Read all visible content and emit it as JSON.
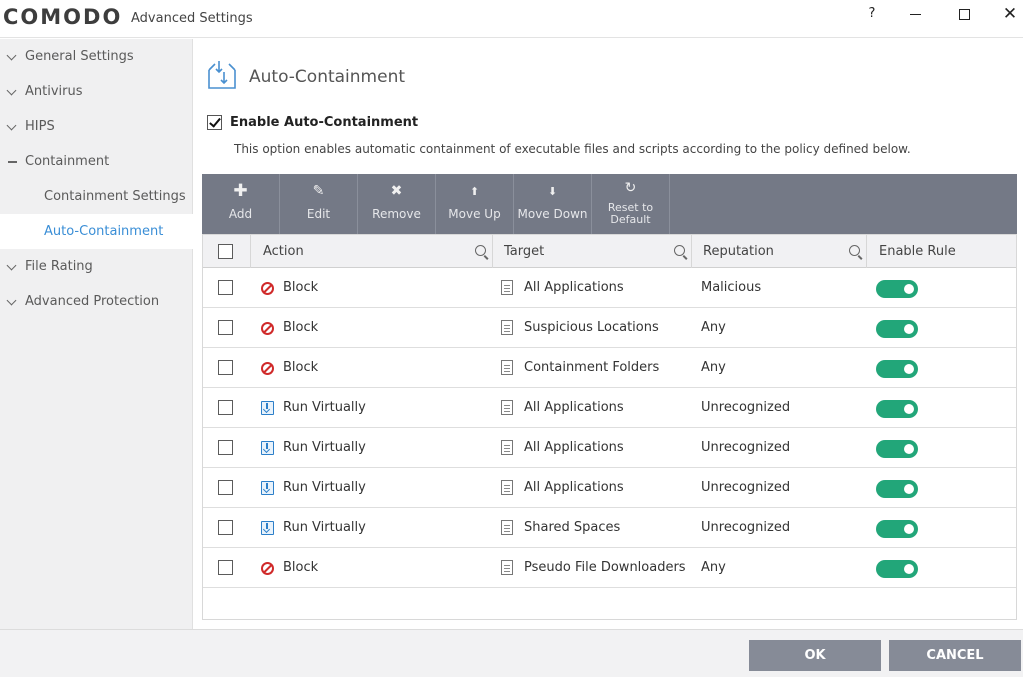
{
  "window": {
    "brand": "COMODO",
    "title": "Advanced Settings",
    "help_label": "?",
    "close_label": "✕"
  },
  "sidebar": {
    "items": [
      {
        "label": "General Settings",
        "state": "collapsed"
      },
      {
        "label": "Antivirus",
        "state": "collapsed"
      },
      {
        "label": "HIPS",
        "state": "collapsed"
      },
      {
        "label": "Containment",
        "state": "expanded"
      },
      {
        "label": "Containment Settings",
        "state": "sub"
      },
      {
        "label": "Auto-Containment",
        "state": "sub-active"
      },
      {
        "label": "File Rating",
        "state": "collapsed"
      },
      {
        "label": "Advanced Protection",
        "state": "collapsed"
      }
    ]
  },
  "page": {
    "title": "Auto-Containment",
    "enable_label": "Enable Auto-Containment",
    "enable_checked": true,
    "description": "This option enables automatic containment of executable files and scripts according to the policy defined below."
  },
  "toolbar": {
    "buttons": [
      {
        "icon": "plus-icon",
        "label": "Add"
      },
      {
        "icon": "edit-icon",
        "label": "Edit"
      },
      {
        "icon": "remove-icon",
        "label": "Remove"
      },
      {
        "icon": "arrow-up-icon",
        "label": "Move Up"
      },
      {
        "icon": "arrow-down-icon",
        "label": "Move Down"
      },
      {
        "icon": "reset-icon",
        "label_line1": "Reset to",
        "label_line2": "Default"
      }
    ]
  },
  "table": {
    "columns": [
      "Action",
      "Target",
      "Reputation",
      "Enable Rule"
    ],
    "rows": [
      {
        "action": "Block",
        "action_icon": "block-icon",
        "target": "All Applications",
        "reputation": "Malicious",
        "enabled": true
      },
      {
        "action": "Block",
        "action_icon": "block-icon",
        "target": "Suspicious Locations",
        "reputation": "Any",
        "enabled": true
      },
      {
        "action": "Block",
        "action_icon": "block-icon",
        "target": "Containment Folders",
        "reputation": "Any",
        "enabled": true
      },
      {
        "action": "Run Virtually",
        "action_icon": "run-virtually-icon",
        "target": "All Applications",
        "reputation": "Unrecognized",
        "enabled": true
      },
      {
        "action": "Run Virtually",
        "action_icon": "run-virtually-icon",
        "target": "All Applications",
        "reputation": "Unrecognized",
        "enabled": true
      },
      {
        "action": "Run Virtually",
        "action_icon": "run-virtually-icon",
        "target": "All Applications",
        "reputation": "Unrecognized",
        "enabled": true
      },
      {
        "action": "Run Virtually",
        "action_icon": "run-virtually-icon",
        "target": "Shared Spaces",
        "reputation": "Unrecognized",
        "enabled": true
      },
      {
        "action": "Block",
        "action_icon": "block-icon",
        "target": "Pseudo File Downloaders",
        "reputation": "Any",
        "enabled": true
      }
    ]
  },
  "footer": {
    "ok_label": "OK",
    "cancel_label": "CANCEL"
  },
  "colors": {
    "accent": "#3a8ed6",
    "toolbar": "#747986",
    "toggle_on": "#22a679",
    "block_red": "#d02a2a",
    "button_gray": "#868b97"
  }
}
